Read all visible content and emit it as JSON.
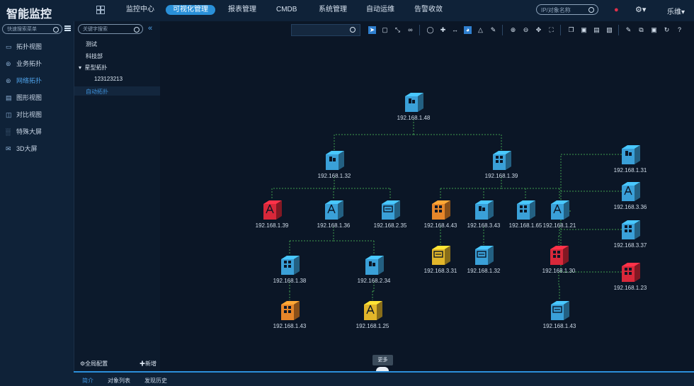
{
  "app": {
    "title": "智能监控"
  },
  "topnav": [
    {
      "label": "监控中心",
      "active": false
    },
    {
      "label": "可视化管理",
      "active": true
    },
    {
      "label": "报表管理",
      "active": false
    },
    {
      "label": "CMDB",
      "active": false
    },
    {
      "label": "系统管理",
      "active": false
    },
    {
      "label": "自动运维",
      "active": false
    },
    {
      "label": "告警收敛",
      "active": false
    }
  ],
  "search_top": {
    "placeholder": "IP/对象名称"
  },
  "user": {
    "name": "乐维"
  },
  "sidebar": {
    "search_placeholder": "快速搜索菜单",
    "items": [
      {
        "label": "拓扑视图",
        "icon": "monitor-icon",
        "active": false
      },
      {
        "label": "业务拓扑",
        "icon": "sitemap-icon",
        "active": false
      },
      {
        "label": "网络拓扑",
        "icon": "network-icon",
        "active": true
      },
      {
        "label": "图形视图",
        "icon": "image-icon",
        "active": false
      },
      {
        "label": "对比视图",
        "icon": "compare-icon",
        "active": false
      },
      {
        "label": "特殊大屏",
        "icon": "bar-chart-icon",
        "active": false
      },
      {
        "label": "3D大屏",
        "icon": "screen-3d-icon",
        "active": false
      }
    ]
  },
  "tree": {
    "search_placeholder": "关键字搜索",
    "nodes": [
      {
        "label": "测试",
        "level": 0,
        "expanded": false,
        "selected": false
      },
      {
        "label": "科技部",
        "level": 0,
        "expanded": false,
        "selected": false
      },
      {
        "label": "星型拓扑",
        "level": 0,
        "expanded": true,
        "selected": false
      },
      {
        "label": "123123213",
        "level": 1,
        "expanded": false,
        "selected": false
      },
      {
        "label": "自动拓扑",
        "level": 0,
        "expanded": false,
        "selected": true
      }
    ],
    "footer": {
      "config_label": "全局配置",
      "add_label": "新增"
    }
  },
  "bottom_tabs": [
    {
      "label": "简介",
      "active": true
    },
    {
      "label": "对象列表",
      "active": false
    },
    {
      "label": "发现历史",
      "active": false
    }
  ],
  "more_label": "更多",
  "colors": {
    "blue": "#3aa0d8",
    "red": "#d8283a",
    "orange": "#e6862a",
    "yellow": "#e2b62a",
    "accent": "#2a90d8"
  },
  "topology": {
    "nodes": [
      {
        "id": "n1",
        "ip": "192.168.1.48",
        "color": "blue",
        "kind": "server"
      },
      {
        "id": "n2",
        "ip": "192.168.1.32",
        "color": "blue",
        "kind": "server"
      },
      {
        "id": "n3",
        "ip": "192.168.1.39",
        "color": "blue",
        "kind": "switch"
      },
      {
        "id": "n4",
        "ip": "192.168.1.39",
        "color": "red",
        "kind": "wireless"
      },
      {
        "id": "n5",
        "ip": "192.168.1.36",
        "color": "blue",
        "kind": "wireless"
      },
      {
        "id": "n6",
        "ip": "192.168.2.35",
        "color": "blue",
        "kind": "storage"
      },
      {
        "id": "n7",
        "ip": "192.168.1.38",
        "color": "blue",
        "kind": "switch"
      },
      {
        "id": "n8",
        "ip": "192.168.2.34",
        "color": "blue",
        "kind": "server"
      },
      {
        "id": "n9",
        "ip": "192.168.1.43",
        "color": "orange",
        "kind": "switch"
      },
      {
        "id": "n10",
        "ip": "192.168.1.25",
        "color": "yellow",
        "kind": "wireless"
      },
      {
        "id": "n11",
        "ip": "192.168.4.43",
        "color": "orange",
        "kind": "switch"
      },
      {
        "id": "n12",
        "ip": "192.168.3.43",
        "color": "blue",
        "kind": "server"
      },
      {
        "id": "n13",
        "ip": "192.168.1.65",
        "color": "blue",
        "kind": "switch"
      },
      {
        "id": "n14",
        "ip": "192.168.1.21",
        "color": "blue",
        "kind": "wireless"
      },
      {
        "id": "n15",
        "ip": "192.168.3.31",
        "color": "yellow",
        "kind": "storage"
      },
      {
        "id": "n16",
        "ip": "192.168.1.32",
        "color": "blue",
        "kind": "storage"
      },
      {
        "id": "n17",
        "ip": "192.168.1.30",
        "color": "red",
        "kind": "switch"
      },
      {
        "id": "n18",
        "ip": "192.168.1.43",
        "color": "blue",
        "kind": "storage"
      },
      {
        "id": "n19",
        "ip": "192.168.1.31",
        "color": "blue",
        "kind": "server"
      },
      {
        "id": "n20",
        "ip": "192.168.3.36",
        "color": "blue",
        "kind": "wireless"
      },
      {
        "id": "n21",
        "ip": "192.168.3.37",
        "color": "blue",
        "kind": "switch"
      },
      {
        "id": "n22",
        "ip": "192.168.1.23",
        "color": "red",
        "kind": "switch"
      }
    ],
    "links": [
      [
        "n1",
        "n2"
      ],
      [
        "n1",
        "n3"
      ],
      [
        "n2",
        "n4"
      ],
      [
        "n2",
        "n5"
      ],
      [
        "n2",
        "n6"
      ],
      [
        "n5",
        "n7"
      ],
      [
        "n5",
        "n8"
      ],
      [
        "n7",
        "n9"
      ],
      [
        "n8",
        "n10"
      ],
      [
        "n3",
        "n11"
      ],
      [
        "n3",
        "n12"
      ],
      [
        "n3",
        "n13"
      ],
      [
        "n3",
        "n14"
      ],
      [
        "n11",
        "n15"
      ],
      [
        "n12",
        "n16"
      ],
      [
        "n14",
        "n17"
      ],
      [
        "n17",
        "n18"
      ],
      [
        "n14",
        "n19"
      ],
      [
        "n14",
        "n20"
      ],
      [
        "n14",
        "n21"
      ],
      [
        "n14",
        "n22"
      ]
    ]
  }
}
